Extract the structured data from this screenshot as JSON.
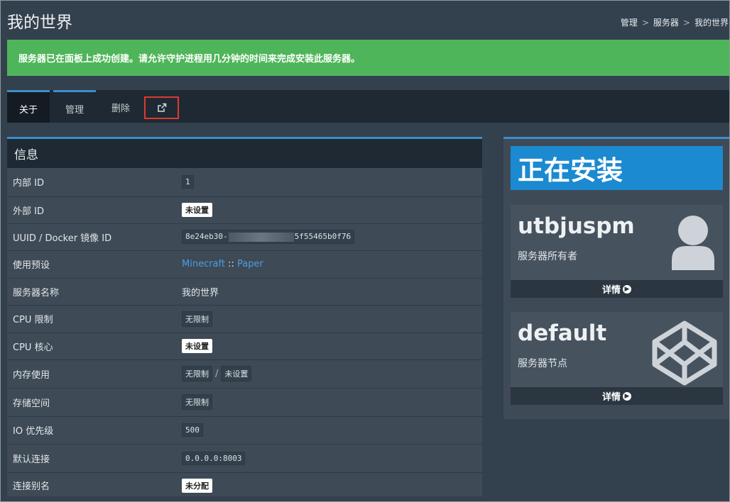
{
  "page": {
    "title": "我的世界"
  },
  "breadcrumb": {
    "items": [
      "管理",
      "服务器",
      "我的世界"
    ],
    "separator": ">"
  },
  "alert": {
    "text": "服务器已在面板上成功创建。请允许守护进程用几分钟的时间来完成安装此服务器。",
    "color": "#4fb55a"
  },
  "tabs": {
    "about": "关于",
    "manage": "管理",
    "delete": "删除",
    "external_icon": "external-link-icon"
  },
  "info": {
    "title": "信息",
    "rows": [
      {
        "label": "内部 ID",
        "value": "1"
      },
      {
        "label": "外部 ID",
        "value": "未设置"
      },
      {
        "label": "UUID / Docker 镜像 ID",
        "value_prefix": "8e24eb30-",
        "value_suffix": "5f55465b0f76"
      },
      {
        "label": "使用预设",
        "nest": "Minecraft",
        "sep": "::",
        "egg": "Paper"
      },
      {
        "label": "服务器名称",
        "value": "我的世界"
      },
      {
        "label": "CPU 限制",
        "value": "无限制"
      },
      {
        "label": "CPU 核心",
        "value": "未设置"
      },
      {
        "label": "内存使用",
        "value": "无限制",
        "sep": "/",
        "value2": "未设置"
      },
      {
        "label": "存储空间",
        "value": "无限制"
      },
      {
        "label": "IO 优先级",
        "value": "500"
      },
      {
        "label": "默认连接",
        "value": "0.0.0.0:8003"
      },
      {
        "label": "连接别名",
        "value": "未分配"
      }
    ]
  },
  "status": {
    "installing": "正在安装",
    "color": "#1b8ad0"
  },
  "owner": {
    "name": "utbjuspm",
    "label": "服务器所有者",
    "more": "详情",
    "icon": "user-icon"
  },
  "node": {
    "name": "default",
    "label": "服务器节点",
    "more": "详情",
    "icon": "codepen-icon"
  },
  "colors": {
    "accent": "#3e8ec8",
    "link": "#4a9fe6",
    "highlight_box": "#e0392f"
  }
}
